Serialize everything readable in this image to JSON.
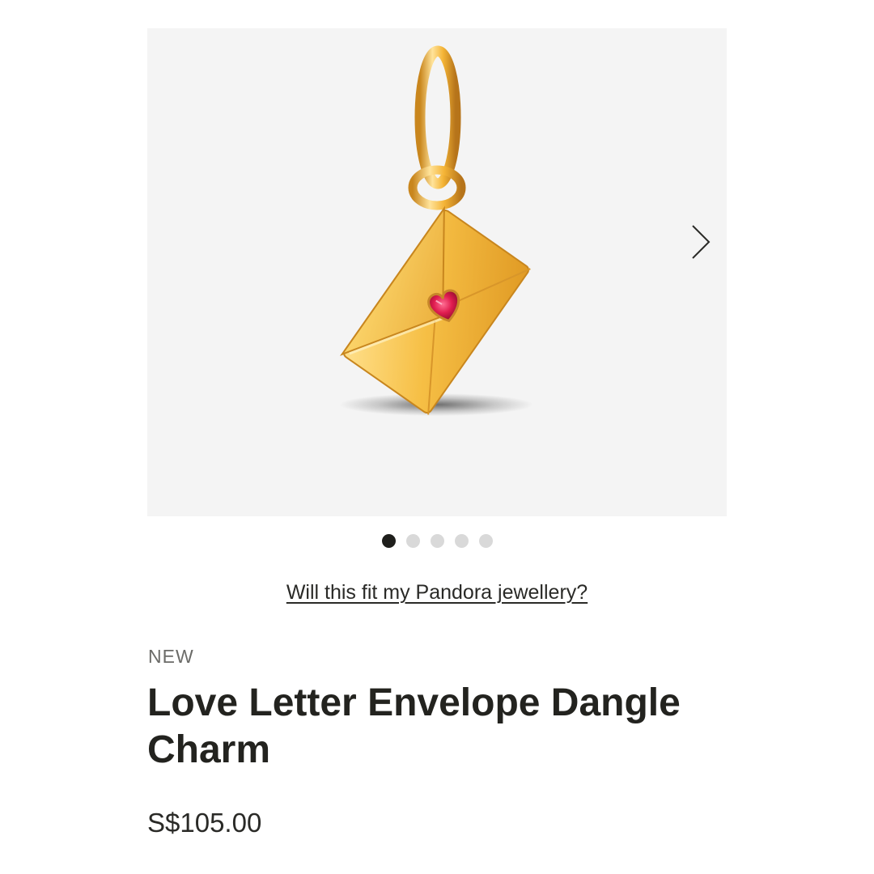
{
  "gallery": {
    "image_alt": "Love Letter Envelope Dangle Charm",
    "next_icon": "chevron-right-icon",
    "dots": [
      {
        "active": true
      },
      {
        "active": false
      },
      {
        "active": false
      },
      {
        "active": false
      },
      {
        "active": false
      }
    ]
  },
  "fit_link": "Will this fit my Pandora jewellery?",
  "product": {
    "badge": "NEW",
    "title": "Love Letter Envelope Dangle Charm",
    "price": "S$105.00"
  },
  "colors": {
    "gallery_bg": "#f4f4f4",
    "gold": "#f2b83a",
    "stone": "#d81b4a",
    "text": "#1f1f1c",
    "dot_active": "#1f1f1c",
    "dot_inactive": "#d9d9d9"
  }
}
